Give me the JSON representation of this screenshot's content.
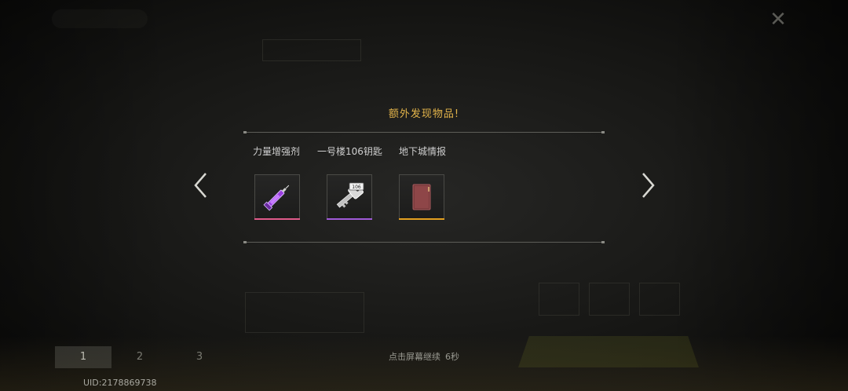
{
  "popup": {
    "title": "额外发现物品!",
    "items": [
      {
        "name": "力量增强剂",
        "icon": "syringe-icon",
        "rarity_color": "#e05a8a"
      },
      {
        "name": "一号楼106钥匙",
        "icon": "key-icon",
        "rarity_color": "#a05ad8"
      },
      {
        "name": "地下城情报",
        "icon": "document-icon",
        "rarity_color": "#e3a020"
      }
    ]
  },
  "navigation": {
    "prev_icon": "chevron-left-icon",
    "next_icon": "chevron-right-icon"
  },
  "footer": {
    "continue_text": "点击屏幕继续",
    "countdown": "6秒",
    "uid": "UID:2178869738"
  },
  "background_tabs": [
    "1",
    "2",
    "3"
  ],
  "colors": {
    "title_gold": "#e3b44a",
    "background": "#171716"
  }
}
